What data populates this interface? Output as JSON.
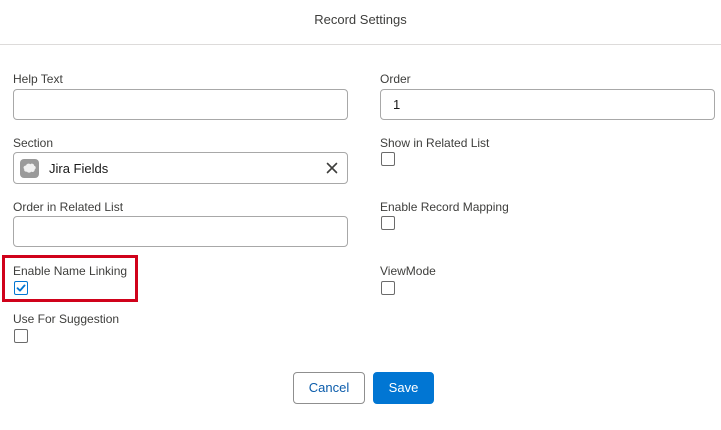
{
  "modal": {
    "title": "Record Settings"
  },
  "fields": {
    "help_text": {
      "label": "Help Text",
      "value": ""
    },
    "section": {
      "label": "Section",
      "value": "Jira Fields",
      "icon": "record-icon"
    },
    "order_in_related_list": {
      "label": "Order in Related List",
      "value": ""
    },
    "enable_name_linking": {
      "label": "Enable Name Linking",
      "checked": true
    },
    "use_for_suggestion": {
      "label": "Use For Suggestion",
      "checked": false
    },
    "order": {
      "label": "Order",
      "value": "1"
    },
    "show_in_related_list": {
      "label": "Show in Related List",
      "checked": false
    },
    "enable_record_mapping": {
      "label": "Enable Record Mapping",
      "checked": false
    },
    "view_mode": {
      "label": "ViewMode",
      "checked": false
    }
  },
  "footer": {
    "cancel_label": "Cancel",
    "save_label": "Save"
  },
  "colors": {
    "brand": "#0176d3",
    "highlight": "#d0021b",
    "border": "#a8a8a8"
  }
}
